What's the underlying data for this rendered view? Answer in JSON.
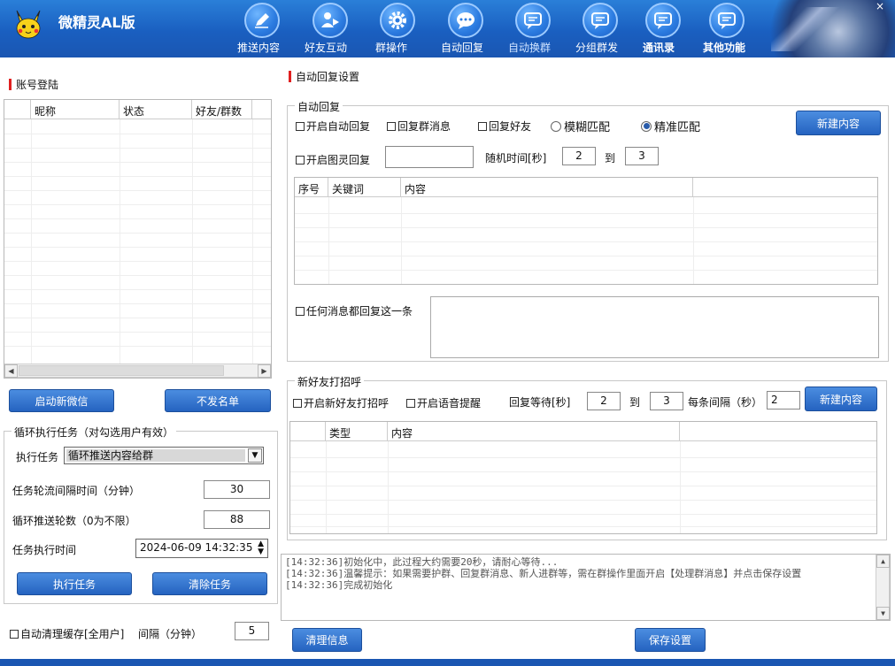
{
  "header": {
    "app_title": "微精灵AL版",
    "close_label": "×",
    "nav": [
      {
        "label": "推送内容",
        "icon": "pen-icon"
      },
      {
        "label": "好友互动",
        "icon": "user-play-icon"
      },
      {
        "label": "群操作",
        "icon": "gear-icon"
      },
      {
        "label": "自动回复",
        "icon": "chat-bubble-icon"
      },
      {
        "label": "自动换群",
        "icon": "message-icon"
      },
      {
        "label": "分组群发",
        "icon": "message-icon"
      },
      {
        "label": "通讯录",
        "icon": "message-icon"
      },
      {
        "label": "其他功能",
        "icon": "message-icon"
      }
    ]
  },
  "left": {
    "account_title": "账号登陆",
    "account_table": {
      "headers": [
        "昵称",
        "状态",
        "好友/群数"
      ]
    },
    "btn_start_wechat": "启动新微信",
    "btn_no_send_list": "不发名单",
    "loop": {
      "legend": "循环执行任务（对勾选用户有效）",
      "task_label": "执行任务",
      "task_value": "循环推送内容给群",
      "interval_label": "任务轮流间隔时间（分钟）",
      "interval_value": "30",
      "rounds_label": "循环推送轮数（0为不限）",
      "rounds_value": "88",
      "time_label": "任务执行时间",
      "time_value": "2024-06-09 14:32:35",
      "btn_exec": "执行任务",
      "btn_clear": "清除任务"
    },
    "auto_clear_label": "自动清理缓存[全用户]",
    "auto_clear_interval_label": "间隔（分钟）",
    "auto_clear_interval_value": "5"
  },
  "right": {
    "title": "自动回复设置",
    "auto_reply": {
      "legend": "自动回复",
      "cb_enable": "开启自动回复",
      "cb_group": "回复群消息",
      "cb_friend": "回复好友",
      "radio_fuzzy": "模糊匹配",
      "radio_exact": "精准匹配",
      "btn_new": "新建内容",
      "cb_tuling": "开启图灵回复",
      "tuling_value": "",
      "random_label": "随机时间[秒]",
      "random_from": "2",
      "to_label": "到",
      "random_to": "3",
      "table_headers": [
        "序号",
        "关键词",
        "内容",
        ""
      ],
      "cb_any": "任何消息都回复这一条",
      "any_value": ""
    },
    "greet": {
      "legend": "新好友打招呼",
      "cb_enable": "开启新好友打招呼",
      "cb_voice": "开启语音提醒",
      "wait_label": "回复等待[秒]",
      "wait_from": "2",
      "to_label": "到",
      "wait_to": "3",
      "each_label": "每条间隔（秒）",
      "each_value": "2",
      "btn_new": "新建内容",
      "table_headers": [
        "",
        "类型",
        "内容",
        ""
      ]
    },
    "log": [
      "[14:32:36]初始化中，此过程大约需要20秒，请耐心等待...",
      "[14:32:36]温馨提示：如果需要护群、回复群消息、新人进群等，需在群操作里面开启【处理群消息】并点击保存设置",
      "[14:32:36]完成初始化"
    ],
    "btn_clear_log": "清理信息",
    "btn_save": "保存设置"
  }
}
